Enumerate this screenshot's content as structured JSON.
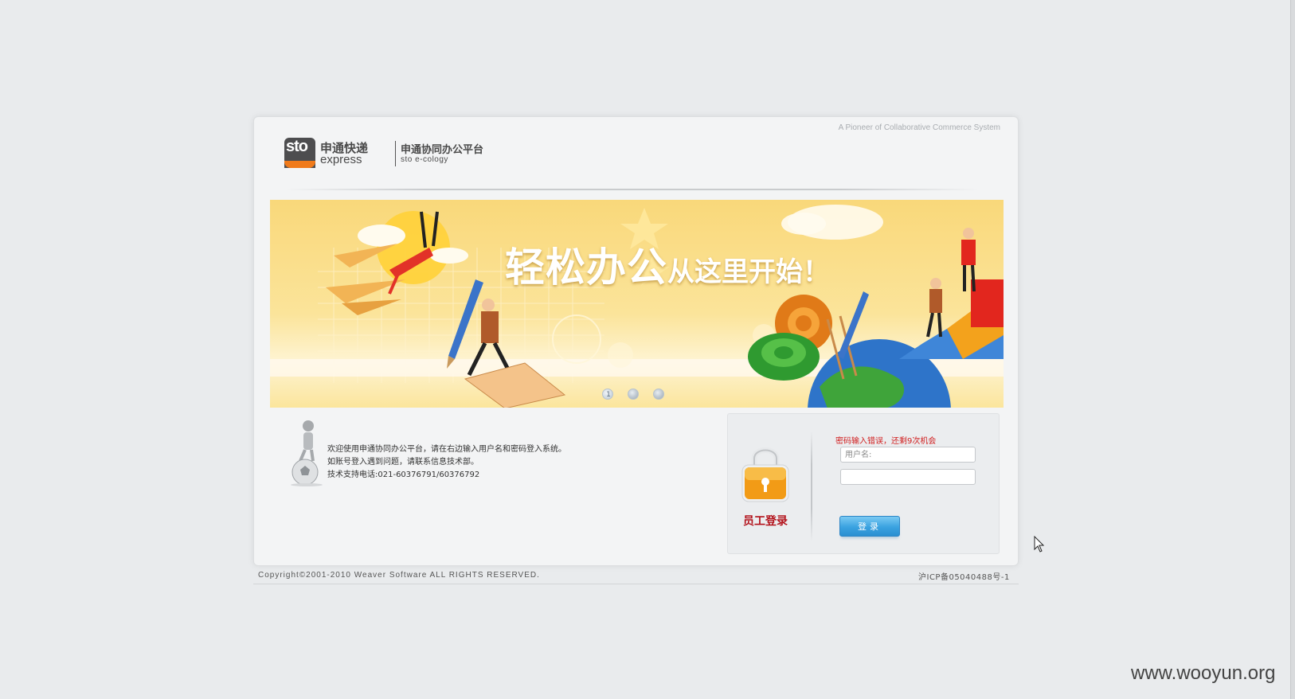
{
  "header": {
    "tagline": "A Pioneer of Collaborative Commerce System",
    "logo": {
      "badge_text": "sto",
      "brand_cn": "申通快递",
      "brand_en": "express",
      "platform_cn": "申通协同办公平台",
      "platform_en": "sto e-cology"
    }
  },
  "banner": {
    "title_big": "轻松办公",
    "title_small": "从这里开始！",
    "slides": [
      {
        "label": "1",
        "active": true
      },
      {
        "label": "",
        "active": false
      },
      {
        "label": "",
        "active": false
      }
    ]
  },
  "welcome": {
    "line1": "欢迎使用申通协同办公平台，请在右边输入用户名和密码登入系统。",
    "line2": "如账号登入遇到问题，请联系信息技术部。",
    "line3": "技术支持电话:021-60376791/60376792"
  },
  "login": {
    "label": "员工登录",
    "error_message": "密码输入错误，还剩9次机会",
    "username_placeholder": "用户名:",
    "password_value": "",
    "submit_label": "登录"
  },
  "footer": {
    "copyright": "Copyright©2001-2010 Weaver Software ALL RIGHTS RESERVED.",
    "icp": "沪ICP备05040488号-1"
  },
  "watermark": "www.wooyun.org",
  "colors": {
    "accent_button": "#3aa2e0",
    "error_text": "#d12020",
    "login_label": "#b3121b",
    "brand_orange": "#f07a1a"
  }
}
